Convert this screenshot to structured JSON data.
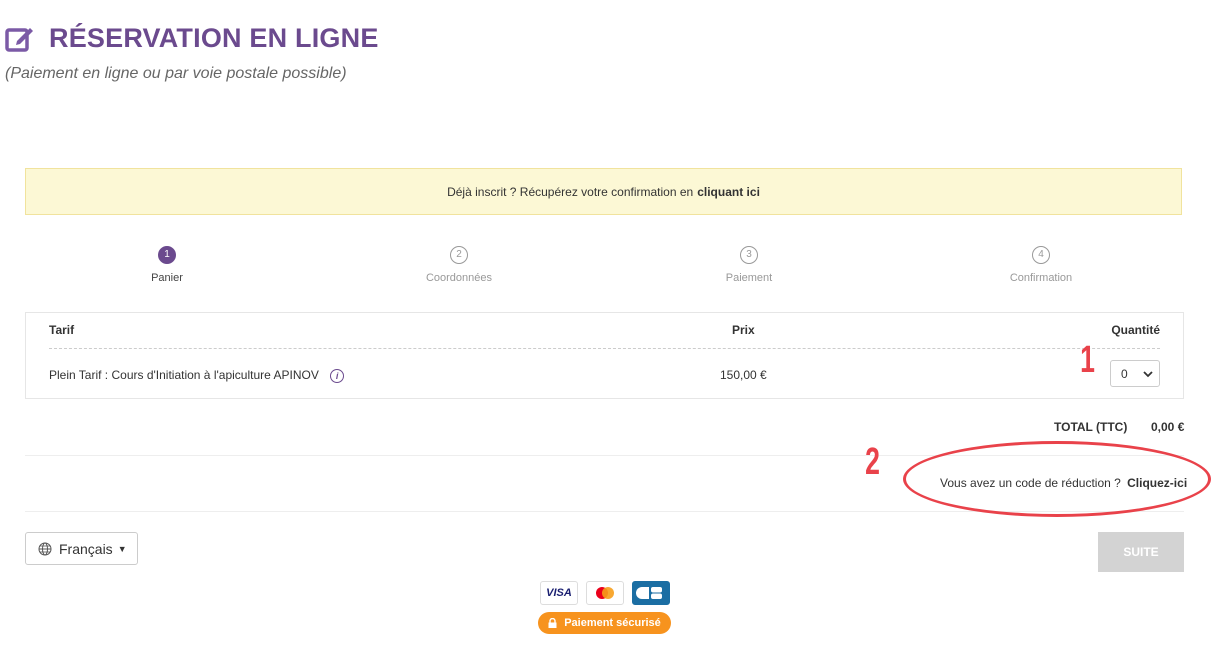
{
  "header": {
    "title": "RÉSERVATION EN LIGNE",
    "subtitle": "(Paiement en ligne ou par voie postale possible)"
  },
  "notice": {
    "text": "Déjà inscrit ? Récupérez votre confirmation en",
    "link": "cliquant ici"
  },
  "steps": [
    {
      "number": "1",
      "label": "Panier",
      "active": true
    },
    {
      "number": "2",
      "label": "Coordonnées",
      "active": false
    },
    {
      "number": "3",
      "label": "Paiement",
      "active": false
    },
    {
      "number": "4",
      "label": "Confirmation",
      "active": false
    }
  ],
  "table": {
    "headers": {
      "tarif": "Tarif",
      "prix": "Prix",
      "quantite": "Quantité"
    },
    "rows": [
      {
        "tarif": "Plein Tarif : Cours d'Initiation à l'apiculture APINOV",
        "prix": "150,00 €",
        "quantite": "0"
      }
    ]
  },
  "total": {
    "label": "TOTAL (TTC)",
    "value": "0,00 €"
  },
  "discount": {
    "text": "Vous avez un code de réduction ?",
    "link": "Cliquez-ici"
  },
  "language": {
    "selected": "Français"
  },
  "actions": {
    "next": "SUITE"
  },
  "payment": {
    "cards": [
      "VISA",
      "mastercard",
      "CB"
    ],
    "secure": "Paiement sécurisé"
  },
  "annotations": {
    "one": "1",
    "two": "2"
  },
  "colors": {
    "brand": "#6b4a8e",
    "annotation": "#e9424a",
    "secure_badge": "#f7931e",
    "notice_bg": "#fcf8d5"
  }
}
